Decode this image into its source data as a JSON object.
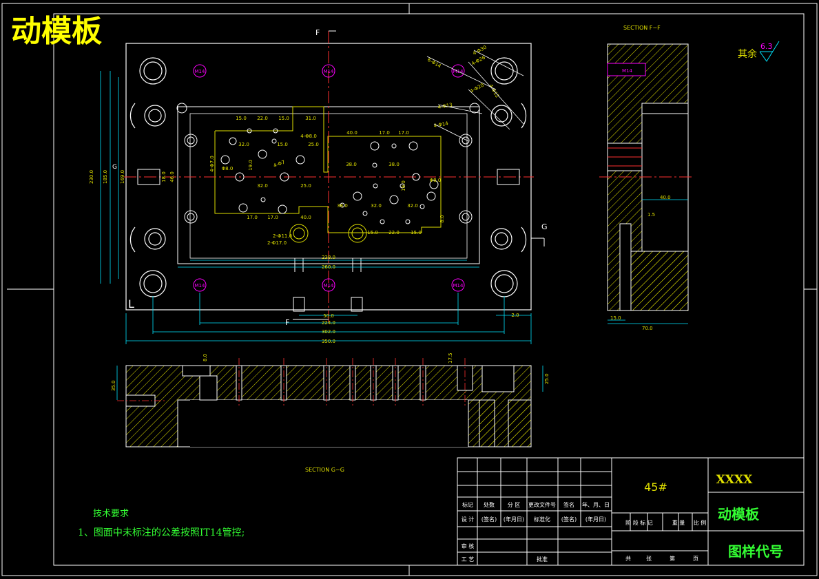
{
  "title_overlay": "动模板",
  "section_ff": {
    "title": "SECTION F−F",
    "labels": [
      "M14",
      "40.0",
      "1.5",
      "15.0",
      "70.0"
    ]
  },
  "section_gg": {
    "title": "SECTION G−G",
    "labels": [
      "8.0",
      "17.5",
      "25.0",
      "35.0"
    ]
  },
  "roughness": {
    "label": "其余",
    "value": "6.3"
  },
  "plan_view": {
    "cut_f_label": "F",
    "cut_g_label": "G",
    "cut_g_label_left": "G",
    "corner_mark": "L",
    "thread_label": "M14",
    "vertical_dims": [
      "230.0",
      "185.0",
      "169.0",
      "18.0",
      "46.0"
    ],
    "bottom_dims": [
      "50.0",
      "224.0",
      "302.0",
      "350.0",
      "2.0"
    ],
    "inner_dims": [
      "238.0",
      "260.0"
    ],
    "hole_labels": [
      "6-Φ14",
      "4-Φ30",
      "4-Φ26",
      "4-Φ20",
      "4-Φ13",
      "4-Φ12",
      "4-Φ14",
      "4-Φ7"
    ],
    "small_dims": [
      "15.0",
      "22.0",
      "15.0",
      "31.0",
      "40.0",
      "17.0",
      "17.0",
      "32.0",
      "25.0",
      "38.0",
      "38.0",
      "19.0",
      "19.0",
      "15.0",
      "32.0",
      "25.0",
      "32.0",
      "32.0",
      "22.0",
      "15.0",
      "15.0",
      "17.0",
      "17.0",
      "40.0",
      "38.0",
      "8.0",
      "4-Φ8.0",
      "4-Φ7.0",
      "2-Φ11.0",
      "2-Φ17.0",
      "Φ8.0",
      "Φ8.0"
    ]
  },
  "tech_requirements": {
    "heading": "技术要求",
    "item": "1、图面中未标注的公差按照IT14管控;"
  },
  "title_block": {
    "material": "45#",
    "company": "XXXX",
    "part_name": "动模板",
    "drawing_code": "图样代号",
    "row_revision": [
      "标记",
      "处数",
      "分 区",
      "更改文件号",
      "签名",
      "年、月、日"
    ],
    "row_design": [
      "设 计",
      "(签名)",
      "(年月日)",
      "标准化",
      "(签名)",
      "(年月日)"
    ],
    "row_review": [
      "审 核"
    ],
    "row_process": [
      "工 艺",
      "批准"
    ],
    "stage_headers": [
      "阶 段 标 记",
      "重 量",
      "比 例"
    ],
    "sheet_footer": [
      "共",
      "张",
      "第",
      "页"
    ]
  },
  "colors": {
    "background": "#000000",
    "outline": "#ffffff",
    "dimension": "#00e5ff",
    "centerline": "#ff3030",
    "hatch": "#e8e800",
    "hole": "#ffffff",
    "thread": "#ff00ff",
    "tech_text": "#33ff33",
    "title_text": "#ffff00"
  }
}
